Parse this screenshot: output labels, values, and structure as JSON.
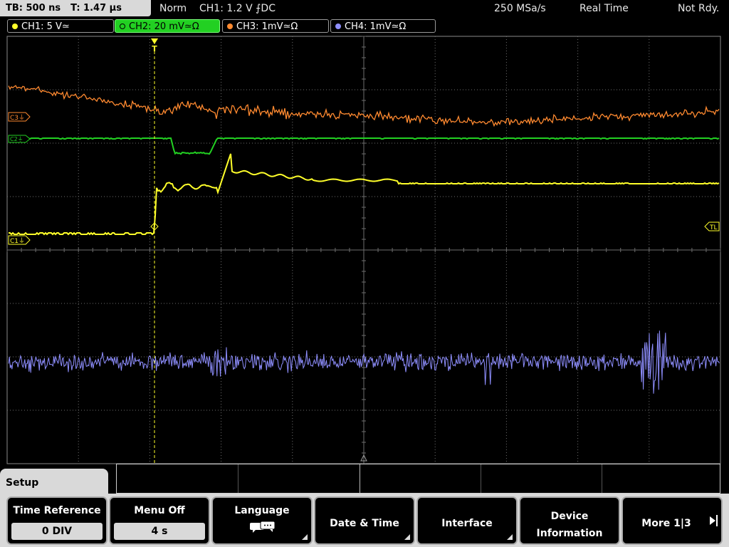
{
  "status": {
    "timebase": "TB: 500 ns",
    "trigger_pos": "T: 1.47 µs",
    "mode": "Norm",
    "trigger": "CH1: 1.2 V ⨍DC",
    "sample_rate": "250 MSa/s",
    "acquisition": "Real Time",
    "state": "Not Rdy."
  },
  "channels": [
    {
      "label": "CH1: 5 V≃",
      "color": "#ffff2a",
      "active": false
    },
    {
      "label": "CH2: 20 mV≃Ω",
      "color": "#22d022",
      "active": true
    },
    {
      "label": "CH3: 1mV≃Ω",
      "color": "#ff8a30",
      "active": false
    },
    {
      "label": "CH4: 1mV≃Ω",
      "color": "#8f8fff",
      "active": false
    }
  ],
  "markers": {
    "c3": "C3⏚",
    "c2": "C2⏚",
    "c1": "C1⏚",
    "trigger_level": "TL",
    "trigger_flag": "T"
  },
  "menu": {
    "tab": "Setup",
    "softkeys": [
      {
        "name": "time-reference",
        "label": "Time Reference",
        "value": "0 DIV"
      },
      {
        "name": "menu-off",
        "label": "Menu Off",
        "value": "4 s"
      },
      {
        "name": "language",
        "label": "Language",
        "icon": "speech-bubbles-icon"
      },
      {
        "name": "date-time",
        "label": "Date & Time"
      },
      {
        "name": "interface",
        "label": "Interface"
      },
      {
        "name": "device-info",
        "label_line1": "Device",
        "label_line2": "Information"
      },
      {
        "name": "more",
        "label": "More 1|3"
      }
    ]
  },
  "colors": {
    "grid": "#6e6e6e",
    "ch1": "#ffff2a",
    "ch2": "#22d022",
    "ch3": "#ff8a30",
    "ch4": "#8f8fff",
    "panel": "#d9d9d9"
  }
}
